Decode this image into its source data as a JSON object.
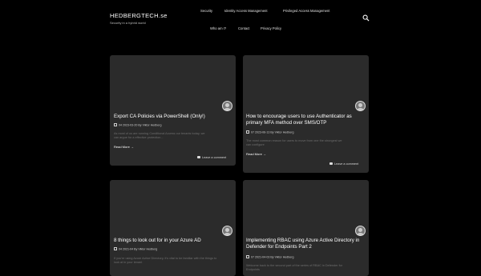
{
  "site": {
    "title": "HEDBERGTECH.se",
    "tagline": "Security in a hybrid world"
  },
  "nav": {
    "primary": [
      "Security",
      "Identity Access Management",
      "Privileged Access Management"
    ],
    "secondary": [
      "Who am I?",
      "Contact",
      "Privacy Policy"
    ]
  },
  "icons": {
    "search": "search-icon",
    "calendar": "calendar-icon",
    "comment": "comment-icon"
  },
  "posts": [
    {
      "title": "Export CA Policies via PowerShell (Only!)",
      "meta": "04 2023-03-20 By Viktor Hedberg",
      "excerpt": "As most of us are running Conditional Access our tenants today, we can argue for a effective protection...",
      "read_more": "Read More →",
      "comment": "Leave a comment"
    },
    {
      "title": "How to encourage users to use Authenticator as primary MFA method over SMS/OTP",
      "meta": "07 2023-06-13 By Viktor Hedberg",
      "excerpt": "The most common reason for users to move from one the strongest we can configure",
      "read_more": "Read More →",
      "comment": "Leave a comment"
    },
    {
      "title": "8 things to look out for in your Azure AD",
      "meta": "04 2021-04 By Viktor Hedberg",
      "excerpt": "If you're using Azure Active Directory, it's vital to be familiar with the things to look at in your tenant",
      "read_more": "",
      "comment": ""
    },
    {
      "title": "Implementing RBAC using Azure Active Directory in Defender for Endpoints Part 2",
      "meta": "07 2021-04-03 By Viktor Hedberg",
      "excerpt": "Welcome back to the second part of the series of RBAC in Defender for Endpoints",
      "read_more": "",
      "comment": ""
    }
  ]
}
